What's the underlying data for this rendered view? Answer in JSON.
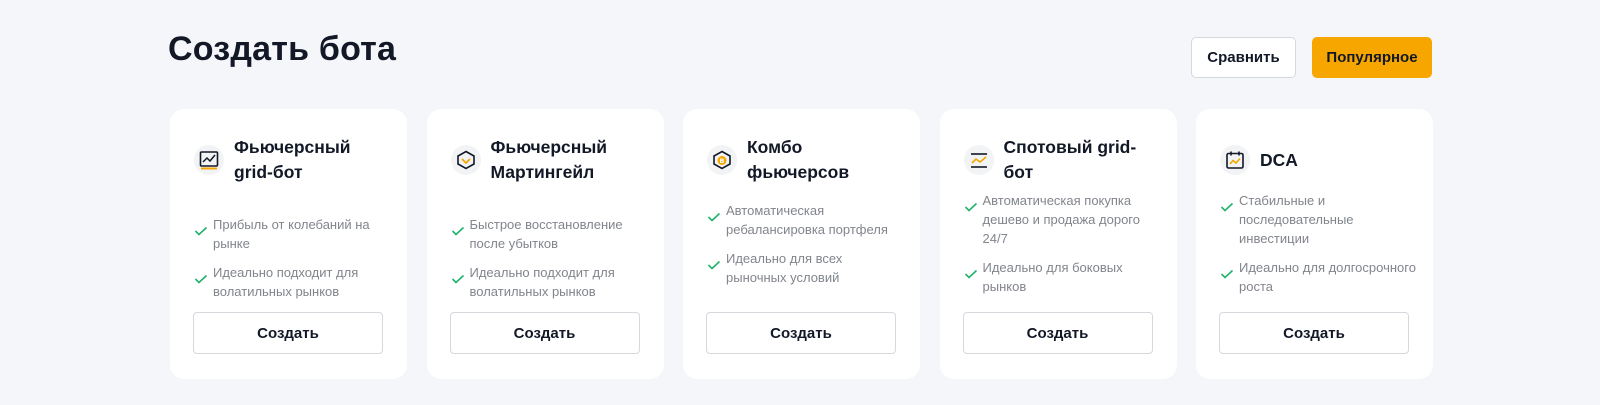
{
  "header": {
    "title": "Создать бота",
    "compare_label": "Сравнить",
    "popular_label": "Популярное"
  },
  "colors": {
    "accent": "#f7a600",
    "check": "#20b26c",
    "background": "#f5f6fa"
  },
  "cards": [
    {
      "name": "Фьючерсный grid-бот",
      "icon": "futures-grid-chart-icon",
      "features": [
        "Прибыль от колебаний на рынке",
        "Идеально подходит для волатильных рынков"
      ],
      "button": "Создать"
    },
    {
      "name": "Фьючерсный Мартингейл",
      "icon": "martingale-cube-icon",
      "features": [
        "Быстрое восстановление после убытков",
        "Идеально подходит для волатильных рынков"
      ],
      "button": "Создать"
    },
    {
      "name": "Комбо фьючерсов",
      "icon": "combo-bitcoin-hexagon-icon",
      "features": [
        "Автоматическая ребалансировка портфеля",
        "Идеально для всех рыночных условий"
      ],
      "button": "Создать"
    },
    {
      "name": "Спотовый grid-бот",
      "icon": "spot-grid-lines-icon",
      "features": [
        "Автоматическая покупка дешево и продажа дорого 24/7",
        "Идеально для боковых рынков"
      ],
      "button": "Создать"
    },
    {
      "name": "DCA",
      "icon": "dca-calendar-icon",
      "features": [
        "Стабильные и последовательные инвестиции",
        "Идеально для долгосрочного роста"
      ],
      "button": "Создать"
    }
  ]
}
